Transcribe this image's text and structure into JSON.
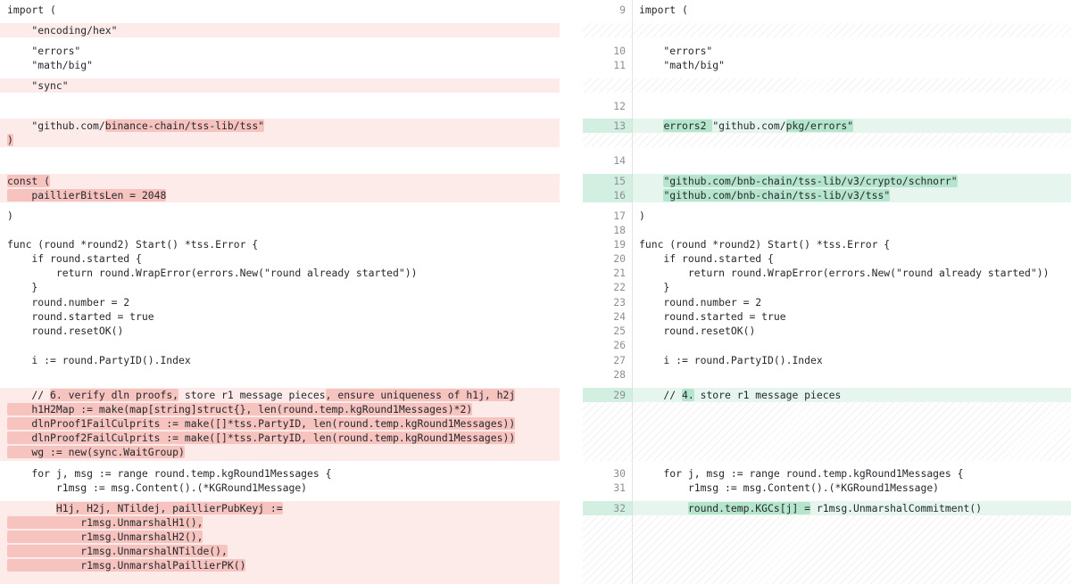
{
  "diff": {
    "left": {
      "import_open": "import (",
      "enc_hex": "    \"encoding/hex\"",
      "errors": "    \"errors\"",
      "mathbig": "    \"math/big\"",
      "sync": "    \"sync\"",
      "tss_a": "    \"github.com/",
      "tss_b": "binance-chain/tss-lib/tss\"",
      "close_paren": ")",
      "const_open": "const (",
      "paillier": "    paillierBitsLen = 2048",
      "close2": ")",
      "func": "func (round *round2) Start() *tss.Error {",
      "if_started": "    if round.started {",
      "return_wrap": "        return round.WrapError(errors.New(\"round already started\"))",
      "close_brace": "    }",
      "number": "    round.number = 2",
      "started_true": "    round.started = true",
      "reset": "    round.resetOK()",
      "index": "    i := round.PartyID().Index",
      "c1_a": "    // ",
      "c1_b": "6. verify dln proofs,",
      "c1_c": " store r1 message pieces",
      "c1_d": ", ensure uniqueness of h1j, h2j",
      "h1h2map": "    h1H2Map := make(map[string]struct{}, len(round.temp.kgRound1Messages)*2)",
      "dln1": "    dlnProof1FailCulprits := make([]*tss.PartyID, len(round.temp.kgRound1Messages))",
      "dln2": "    dlnProof2FailCulprits := make([]*tss.PartyID, len(round.temp.kgRound1Messages))",
      "wg": "    wg := new(sync.WaitGroup)",
      "for": "    for j, msg := range round.temp.kgRound1Messages {",
      "r1msg": "        r1msg := msg.Content().(*KGRound1Message)",
      "h1j_a": "        ",
      "h1j_b": "H1j, H2j, NTildej, paillierPubKeyj :=",
      "un_h1": "            r1msg.UnmarshalH1(),",
      "un_h2": "            r1msg.UnmarshalH2(),",
      "un_nt": "            r1msg.UnmarshalNTilde(),",
      "un_pk": "            r1msg.UnmarshalPaillierPK()"
    },
    "right": {
      "n9": "9",
      "import_open": "import (",
      "n10": "10",
      "errors": "    \"errors\"",
      "n11": "11",
      "mathbig": "    \"math/big\"",
      "n12": "12",
      "n13": "13",
      "err2_a": "    ",
      "err2_b": "errors2 ",
      "err2_c": "\"github.com/",
      "err2_d": "pkg/errors\"",
      "n14": "14",
      "n15": "15",
      "schnorr_a": "    ",
      "schnorr_b": "\"github.com/bnb-chain/tss-lib/v3/crypto/schnorr\"",
      "n16": "16",
      "tss_a": "    ",
      "tss_b": "\"github.com/bnb-chain/tss-lib/v3/tss\"",
      "n17": "17",
      "close_paren": ")",
      "n18": "18",
      "n19": "19",
      "func": "func (round *round2) Start() *tss.Error {",
      "n20": "20",
      "if_started": "    if round.started {",
      "n21": "21",
      "return_wrap": "        return round.WrapError(errors.New(\"round already started\"))",
      "n22": "22",
      "close_brace": "    }",
      "n23": "23",
      "number": "    round.number = 2",
      "n24": "24",
      "started_true": "    round.started = true",
      "n25": "25",
      "reset": "    round.resetOK()",
      "n26": "26",
      "n27": "27",
      "index": "    i := round.PartyID().Index",
      "n28": "28",
      "n29": "29",
      "c_a": "    // ",
      "c_b": "4.",
      "c_c": " store r1 message pieces",
      "n30": "30",
      "for": "    for j, msg := range round.temp.kgRound1Messages {",
      "n31": "31",
      "r1msg": "        r1msg := msg.Content().(*KGRound1Message)",
      "n32": "32",
      "kgc_a": "        ",
      "kgc_b": "round.temp.KGCs[j] =",
      "kgc_c": " r1msg.UnmarshalCommitment()"
    }
  }
}
